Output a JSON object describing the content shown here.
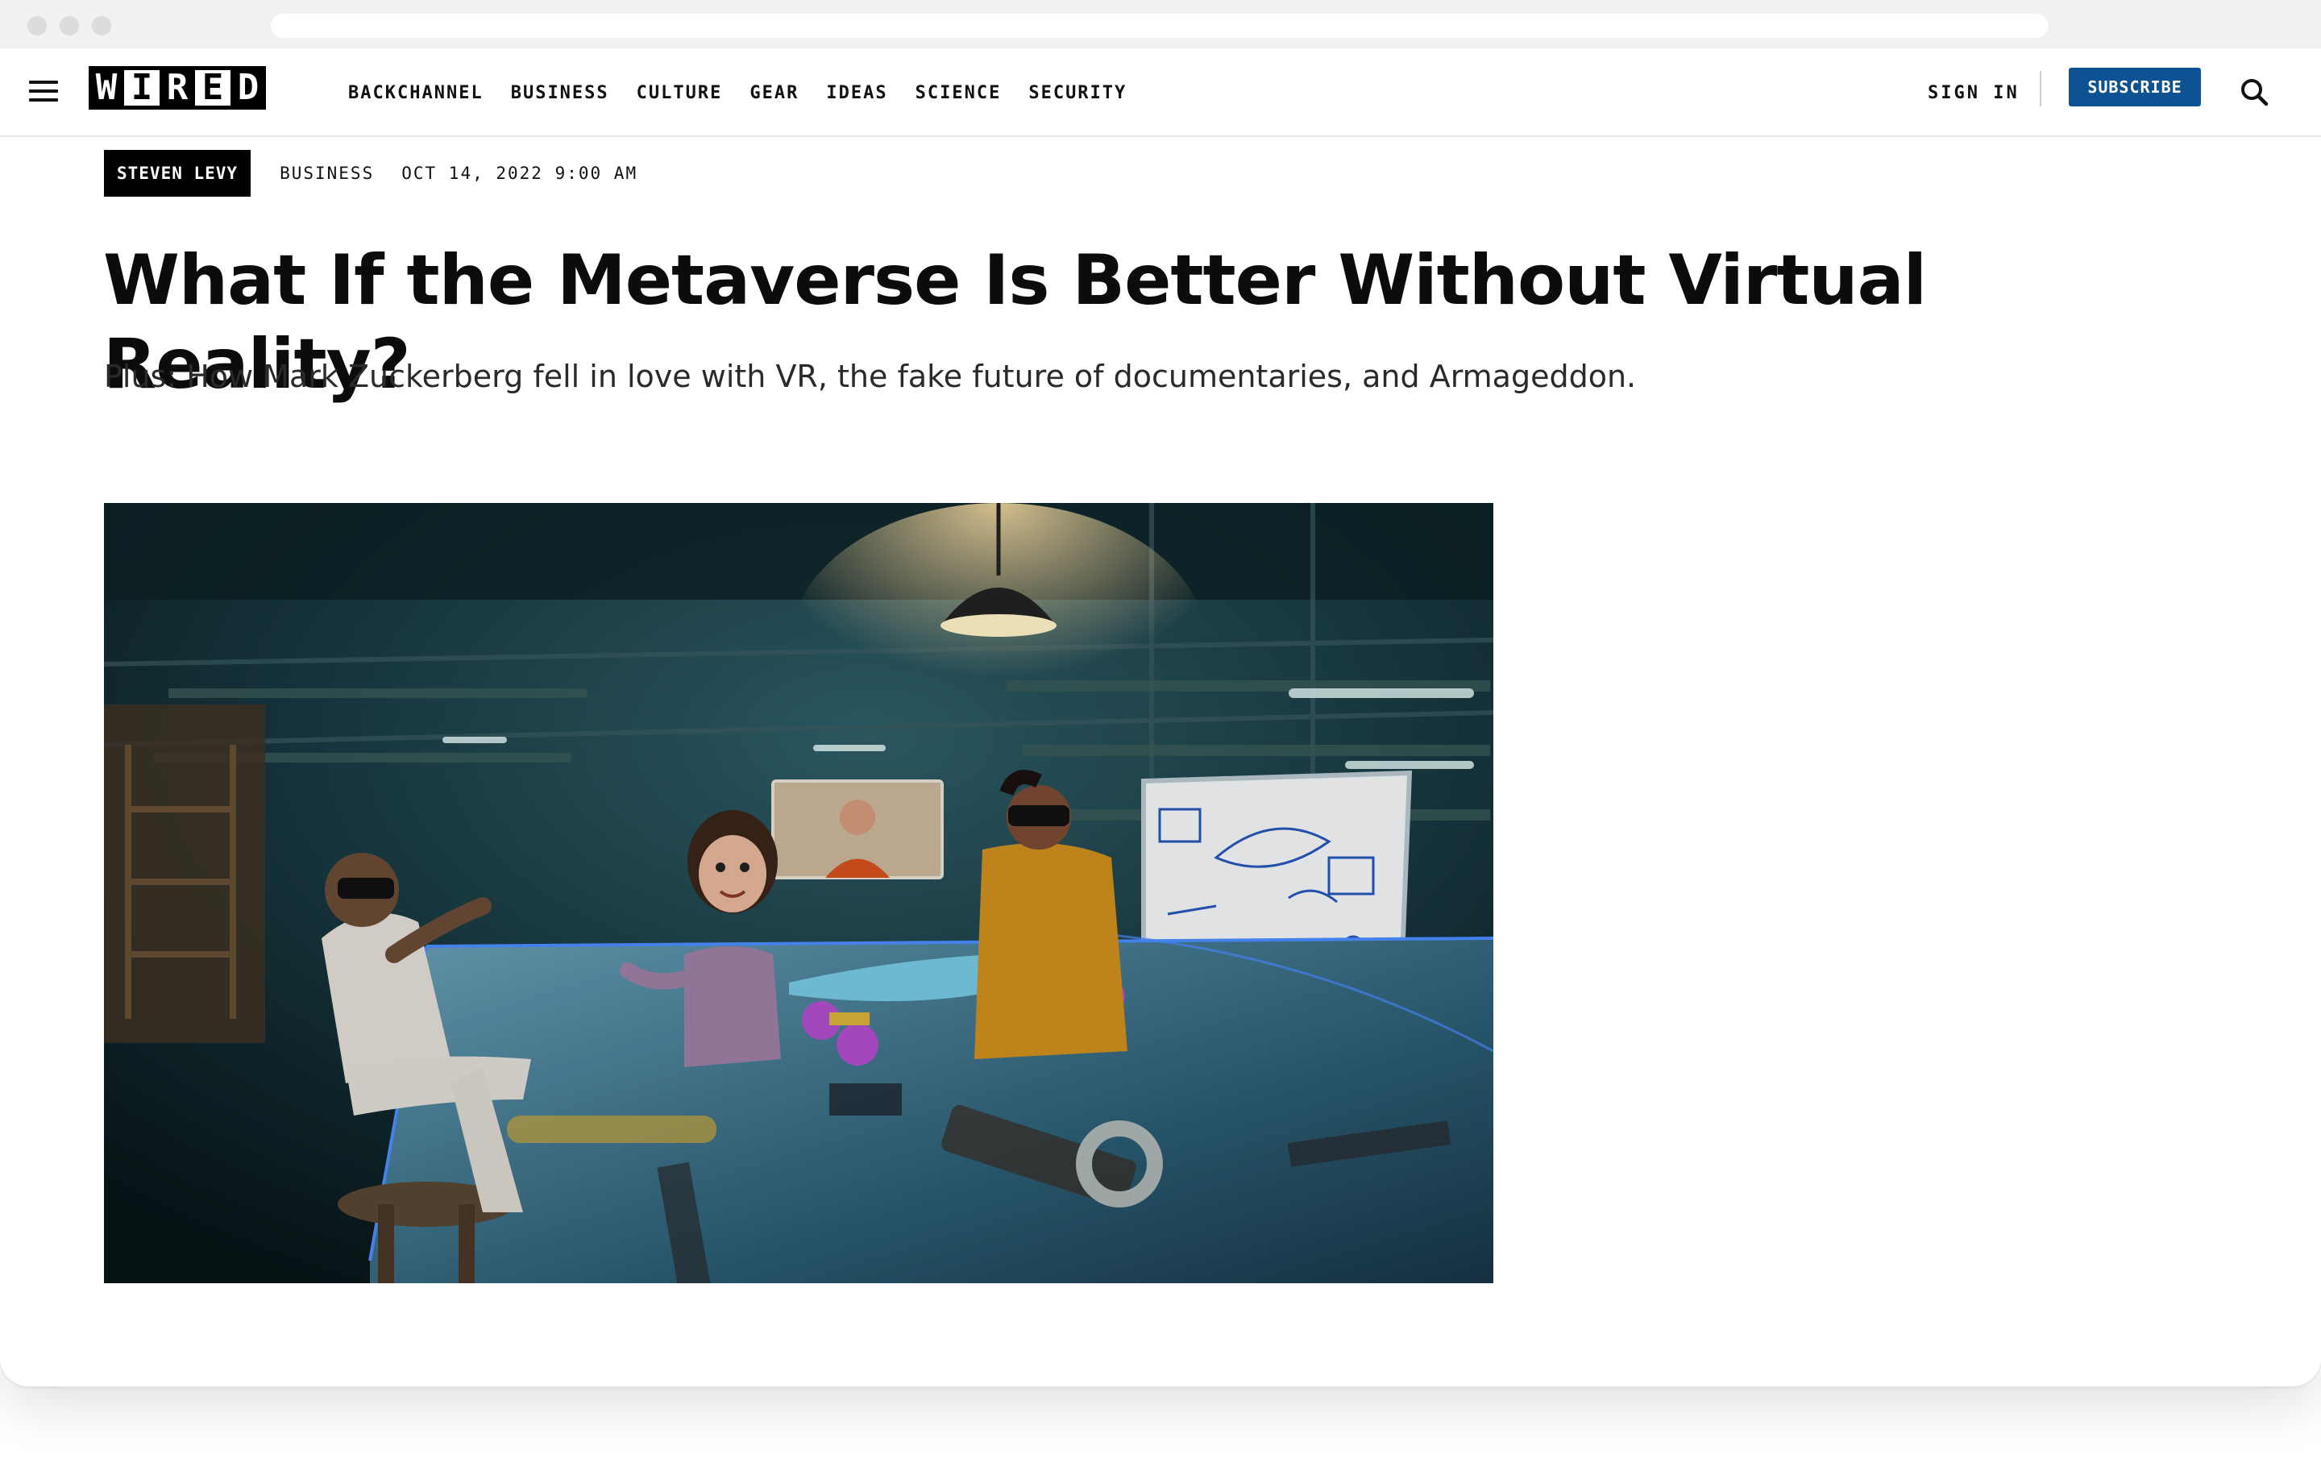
{
  "header": {
    "logo": [
      "W",
      "I",
      "R",
      "E",
      "D"
    ],
    "nav": [
      "BACKCHANNEL",
      "BUSINESS",
      "CULTURE",
      "GEAR",
      "IDEAS",
      "SCIENCE",
      "SECURITY"
    ],
    "sign_in": "SIGN IN",
    "subscribe": "SUBSCRIBE"
  },
  "article": {
    "author": "STEVEN LEVY",
    "section": "BUSINESS",
    "date": "OCT 14, 2022 9:00 AM",
    "headline": "What If the Metaverse Is Better Without Virtual Reality?",
    "dek": "Plus: How Mark Zuckerberg fell in love with VR, the fake future of documentaries, and Armageddon."
  },
  "colors": {
    "subscribe_bg": "#0d5394",
    "text": "#0c0c0c",
    "badge_bg": "#000000"
  },
  "icons": {
    "menu": "hamburger-icon",
    "search": "search-icon"
  }
}
